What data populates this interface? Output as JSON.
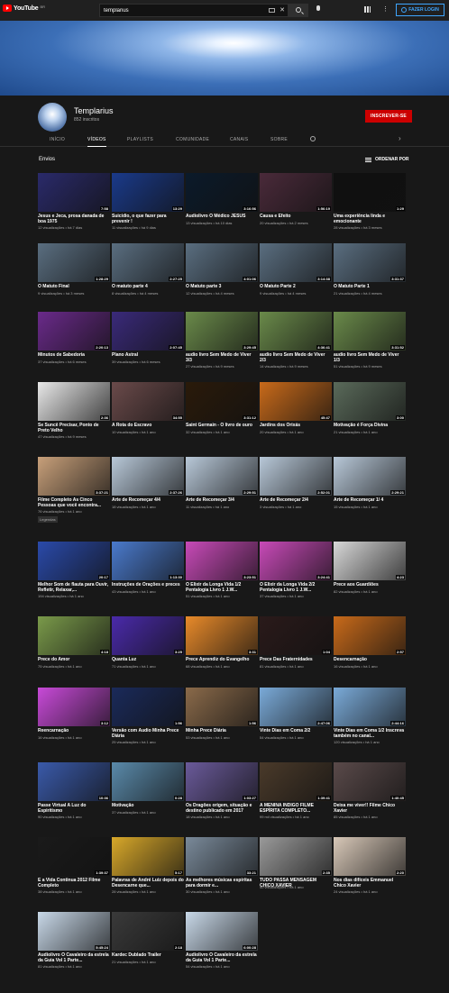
{
  "header": {
    "logo_text": "YouTube",
    "country": "BR",
    "search_value": "templarius",
    "login_label": "FAZER LOGIN"
  },
  "channel": {
    "name": "Templarius",
    "subscribers": "852 inscritos",
    "subscribe_label": "INSCREVER-SE"
  },
  "tabs": [
    "INÍCIO",
    "VÍDEOS",
    "PLAYLISTS",
    "COMUNIDADE",
    "CANAIS",
    "SOBRE"
  ],
  "active_tab": "VÍDEOS",
  "section": {
    "title": "Envios",
    "sort_label": "ORDENAR POR"
  },
  "videos": [
    {
      "title": "Jesus e Jeca, prosa danada de boa 1975",
      "meta": "12 visualizações • há 7 dias",
      "duration": "7:58",
      "color": "#2a2a6a"
    },
    {
      "title": "Suicídio, o que fazer para prevenir !",
      "meta": "11 visualizações • há 9 dias",
      "duration": "13:29",
      "color": "#1a3a8a"
    },
    {
      "title": "Audiolivro O Médico JESUS",
      "meta": "13 visualizações • há 10 dias",
      "duration": "3:16:56",
      "color": "#0b1a2a"
    },
    {
      "title": "Causa e Efeito",
      "meta": "20 visualizações • há 2 meses",
      "duration": "1:56:19",
      "color": "#4a2a3a"
    },
    {
      "title": "Uma experiência linda e emocionante",
      "meta": "28 visualizações • há 3 meses",
      "duration": "1:29",
      "color": "#101010"
    },
    {
      "title": "O Matuto Final",
      "meta": "9 visualizações • há 3 meses",
      "duration": "1:28:29",
      "color": "#5a6e80"
    },
    {
      "title": "O matuto parte 4",
      "meta": "8 visualizações • há 4 meses",
      "duration": "2:27:25",
      "color": "#5a6e80"
    },
    {
      "title": "O Matuto parte 3",
      "meta": "12 visualizações • há 4 meses",
      "duration": "4:01:06",
      "color": "#5a6e80"
    },
    {
      "title": "O Matuto Parte 2",
      "meta": "9 visualizações • há 4 meses",
      "duration": "3:14:38",
      "color": "#5a6e80"
    },
    {
      "title": "O Matuto Parte 1",
      "meta": "21 visualizações • há 4 meses",
      "duration": "3:31:37",
      "color": "#5a6e80"
    },
    {
      "title": "Minutos de Sabedoria",
      "meta": "37 visualizações • há 6 meses",
      "duration": "2:20:13",
      "color": "#6a2a8a"
    },
    {
      "title": "Plano Astral",
      "meta": "39 visualizações • há 6 meses",
      "duration": "2:07:45",
      "color": "#3a2a7a"
    },
    {
      "title": "audio livro Sem Medo de Viver 3/3",
      "meta": "27 visualizações • há 9 meses",
      "duration": "3:29:45",
      "color": "#6a8a4a"
    },
    {
      "title": "audio livro Sem Medo de Viver 2/3",
      "meta": "14 visualizações • há 9 meses",
      "duration": "4:36:41",
      "color": "#6a8a4a"
    },
    {
      "title": "audio livro Sem Medo de Viver 1/3",
      "meta": "51 visualizações • há 9 meses",
      "duration": "3:31:52",
      "color": "#6a8a4a"
    },
    {
      "title": "Se Suncê Precisar, Ponto de Preto Velho",
      "meta": "47 visualizações • há 9 meses",
      "duration": "2:36",
      "color": "#e8e8e8"
    },
    {
      "title": "A Rota do Escravo",
      "meta": "10 visualizações • há 1 ano",
      "duration": "34:55",
      "color": "#6a4a4a"
    },
    {
      "title": "Saint Germain - O livro de ouro",
      "meta": "32 visualizações • há 1 ano",
      "duration": "3:31:12",
      "color": "#2a1a0a"
    },
    {
      "title": "Jardins dos Orixás",
      "meta": "20 visualizações • há 1 ano",
      "duration": "45:47",
      "color": "#c86a1a"
    },
    {
      "title": "Motivação é Força Divina",
      "meta": "21 visualizações • há 1 ano",
      "duration": "3:00",
      "color": "#5a6a5a"
    },
    {
      "title": "Filme Completo As Cinco Pessoas que você encontra...",
      "meta": "76 visualizações • há 1 ano",
      "duration": "3:37:21",
      "color": "#c8a07a",
      "badge": "Legendas"
    },
    {
      "title": "Arte de Recomeçar 4/4",
      "meta": "18 visualizações • há 1 ano",
      "duration": "2:37:26",
      "color": "#b8c8d8"
    },
    {
      "title": "Arte de Recomeçar 3/4",
      "meta": "11 visualizações • há 1 ano",
      "duration": "2:29:51",
      "color": "#b8c8d8"
    },
    {
      "title": "Arte de Recomeçar 2/4",
      "meta": "3 visualizações • há 1 ano",
      "duration": "2:52:01",
      "color": "#b8c8d8"
    },
    {
      "title": "Arte de Recomeçar 1/ 4",
      "meta": "15 visualizações • há 1 ano",
      "duration": "2:29:21",
      "color": "#b8c8d8"
    },
    {
      "title": "Melhor Som de flauta para Ouvir, Refletir, Relaxar,...",
      "meta": "194 visualizações • há 1 ano",
      "duration": "20:17",
      "color": "#2a4aaa"
    },
    {
      "title": "Instruções de Orações e preces",
      "meta": "43 visualizações • há 1 ano",
      "duration": "1:13:30",
      "color": "#4a7acc"
    },
    {
      "title": "O Elixir da Longa Vida 1/2 Pentalogia Livro 1 J.W...",
      "meta": "51 visualizações • há 1 ano",
      "duration": "3:23:51",
      "color": "#c84ab8"
    },
    {
      "title": "O Elixir da Longa Vida 2/2 Pentalogia Livro 1 J.W...",
      "meta": "37 visualizações • há 1 ano",
      "duration": "3:24:41",
      "color": "#c84ab8"
    },
    {
      "title": "Prece aos Guardiões",
      "meta": "82 visualizações • há 1 ano",
      "duration": "4:23",
      "color": "#d8d8d8"
    },
    {
      "title": "Prece do Amor",
      "meta": "75 visualizações • há 1 ano",
      "duration": "4:18",
      "color": "#7a9a4a"
    },
    {
      "title": "Quanta Luz",
      "meta": "71 visualizações • há 1 ano",
      "duration": "3:25",
      "color": "#4a2aaa"
    },
    {
      "title": "Prece Aprendiz do Evangelho",
      "meta": "68 visualizações • há 1 ano",
      "duration": "3:31",
      "color": "#e88a2a"
    },
    {
      "title": "Prece Das Fraternidades",
      "meta": "81 visualizações • há 1 ano",
      "duration": "1:04",
      "color": "#2a1a1a"
    },
    {
      "title": "Desencarnação",
      "meta": "16 visualizações • há 1 ano",
      "duration": "2:57",
      "color": "#c86a1a"
    },
    {
      "title": "Reencarnação",
      "meta": "16 visualizações • há 1 ano",
      "duration": "3:12",
      "color": "#c84ad8"
    },
    {
      "title": "Versão com Áudio Minha Prece Diária",
      "meta": "25 visualizações • há 1 ano",
      "duration": "1:56",
      "color": "#1a2a5a"
    },
    {
      "title": "Minha Prece Diária",
      "meta": "53 visualizações • há 1 ano",
      "duration": "1:56",
      "color": "#8a6a4a"
    },
    {
      "title": "Vinte Dias em Coma 2/2",
      "meta": "54 visualizações • há 1 ano",
      "duration": "2:47:06",
      "color": "#7aaad8"
    },
    {
      "title": "Vinte Dias em Coma 1/2 Inscreva também no canal...",
      "meta": "120 visualizações • há 1 ano",
      "duration": "2:44:16",
      "color": "#7aaad8"
    },
    {
      "title": "Passe Virtual A Luz do Espiritismo",
      "meta": "90 visualizações • há 1 ano",
      "duration": "10:36",
      "color": "#3a5aaa"
    },
    {
      "title": "Motivação",
      "meta": "37 visualizações • há 1 ano",
      "duration": "0:28",
      "color": "#5a8aaa"
    },
    {
      "title": "Os Dragões origem, situação e destino publicado em 2017",
      "meta": "18 visualizações • há 1 ano",
      "duration": "1:03:27",
      "color": "#6a5a9a"
    },
    {
      "title": "A MENINA ÍNDIGO FILME ESPÍRITA COMPLETO...",
      "meta": "99 mil visualizações • há 1 ano",
      "duration": "1:39:41",
      "color": "#4a3a2a"
    },
    {
      "title": "Deixa me viver!! Filme Chico Xavier",
      "meta": "85 visualizações • há 1 ano",
      "duration": "1:40:45",
      "color": "#5a4a4a"
    },
    {
      "title": "E a Vida Continua 2012 Filme Completo",
      "meta": "38 visualizações • há 1 ano",
      "duration": "1:39:37",
      "color": "#1a1a1a"
    },
    {
      "title": "Palavras de André Luiz depois do Desencarne que...",
      "meta": "28 visualizações • há 1 ano",
      "duration": "5:17",
      "color": "#d8a82a"
    },
    {
      "title": "As melhores músicas espíritas para dormir e...",
      "meta": "30 visualizações • há 1 ano",
      "duration": "33:21",
      "color": "#7a8a9a"
    },
    {
      "title": "TUDO PASSA MENSAGEM CHICO XAVIER",
      "meta": "40 visualizações • há 1 ano",
      "duration": "2:35",
      "color": "#9a9a9a"
    },
    {
      "title": "Nos dias difíceis Emmanuel Chico Xavier",
      "meta": "24 visualizações • há 1 ano",
      "duration": "2:20",
      "color": "#d8c8b8"
    },
    {
      "title": "Audiolivro O Cavaleiro da estrela da Guia Vol 1 Parte...",
      "meta": "81 visualizações • há 1 ano",
      "duration": "5:45:24",
      "color": "#c8d8e8"
    },
    {
      "title": "Kardec Dublado Trailer",
      "meta": "21 visualizações • há 1 ano",
      "duration": "2:18",
      "color": "#3a3a3a"
    },
    {
      "title": "Audiolivro O Cavaleiro da estrela da Guia Vol 1 Parte...",
      "meta": "54 visualizações • há 1 ano",
      "duration": "6:00:28",
      "color": "#c8d8e8"
    }
  ]
}
